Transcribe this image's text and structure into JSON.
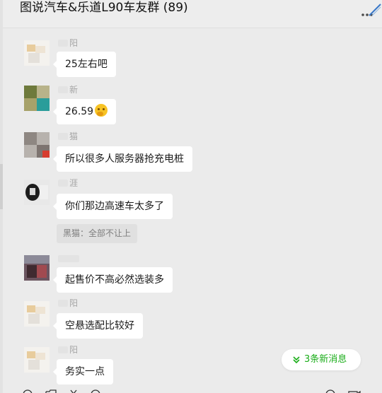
{
  "header": {
    "title": "图说汽车&乐道L90车友群 (89)"
  },
  "messages": [
    {
      "name": "阳",
      "text": "25左右吧"
    },
    {
      "name": "新",
      "text": "26.59"
    },
    {
      "name": "猫",
      "text": "所以很多人服务器抢充电桩"
    },
    {
      "name": "涯",
      "text": "你们那边高速车太多了"
    },
    {
      "name": "",
      "text": "起售价不高必然选装多"
    },
    {
      "name": "阳",
      "text": "空悬选配比较好"
    },
    {
      "name": "阳",
      "text": "务实一点"
    }
  ],
  "quote": {
    "text": "黑猫：全部不让上"
  },
  "new_messages": {
    "label": "3条新消息"
  },
  "icons": [
    "more-icon",
    "chevron-double-down-icon",
    "emoji-icon",
    "folder-icon",
    "scissors-icon",
    "chat-icon",
    "phone-icon",
    "video-icon"
  ],
  "colors": {
    "accent": "#1aad19",
    "background": "#ebebeb",
    "bubble": "#ffffff"
  }
}
